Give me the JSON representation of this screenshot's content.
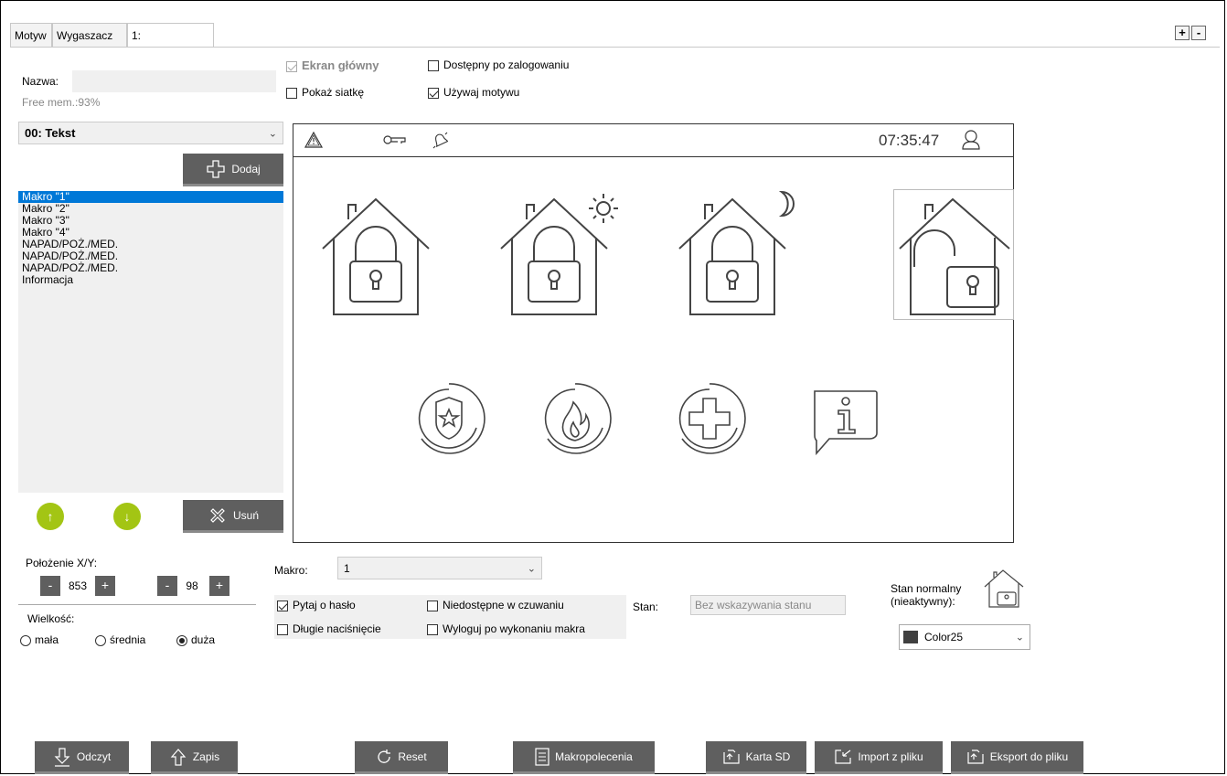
{
  "tabs": [
    {
      "label": "Motyw",
      "active": false
    },
    {
      "label": "Wygaszacz",
      "active": false
    },
    {
      "label": "1:",
      "active": true
    }
  ],
  "tab_controls": {
    "add": "+",
    "remove": "-"
  },
  "name_label": "Nazwa:",
  "name_value": "",
  "free_mem": "Free mem.:93%",
  "element_select": "00: Tekst",
  "add_button": "Dodaj",
  "macro_list": [
    {
      "label": "Makro \"1\"",
      "selected": true
    },
    {
      "label": "Makro \"2\"",
      "selected": false
    },
    {
      "label": "Makro \"3\"",
      "selected": false
    },
    {
      "label": "Makro \"4\"",
      "selected": false
    },
    {
      "label": "NAPAD/POŻ./MED.",
      "selected": false
    },
    {
      "label": "NAPAD/POŻ./MED.",
      "selected": false
    },
    {
      "label": "NAPAD/POŻ./MED.",
      "selected": false
    },
    {
      "label": "Informacja",
      "selected": false
    }
  ],
  "up_button": "↑",
  "down_button": "↓",
  "delete_button": "Usuń",
  "options": {
    "main_screen": {
      "label": "Ekran główny",
      "checked": true,
      "disabled": true
    },
    "available_after_login": {
      "label": "Dostępny po zalogowaniu",
      "checked": false
    },
    "show_grid": {
      "label": "Pokaż siatkę",
      "checked": false
    },
    "use_theme": {
      "label": "Używaj motywu",
      "checked": true
    }
  },
  "preview": {
    "clock": "07:35:47",
    "top_icons": [
      "warning-icon",
      "key-icon",
      "bell-icon",
      "user-icon"
    ],
    "row1_icons": [
      "house-lock-icon",
      "house-lock-day-icon",
      "house-lock-night-icon",
      "house-unlock-icon"
    ],
    "row2_icons": [
      "police-badge-icon",
      "fire-icon",
      "medical-cross-icon",
      "info-icon"
    ]
  },
  "position": {
    "label": "Położenie X/Y:",
    "x": "853",
    "y": "98",
    "minus": "-",
    "plus": "+"
  },
  "size": {
    "label": "Wielkość:",
    "options": [
      {
        "label": "mała",
        "checked": false
      },
      {
        "label": "średnia",
        "checked": false
      },
      {
        "label": "duża",
        "checked": true
      }
    ]
  },
  "macro": {
    "label": "Makro:",
    "value": "1"
  },
  "macro_options": {
    "ask_password": {
      "label": "Pytaj o hasło",
      "checked": true
    },
    "unavailable_armed": {
      "label": "Niedostępne w czuwaniu",
      "checked": false
    },
    "long_press": {
      "label": "Długie naciśnięcie",
      "checked": false
    },
    "logout_after": {
      "label": "Wyloguj po wykonaniu makra",
      "checked": false
    }
  },
  "state": {
    "label": "Stan:",
    "value": "Bez wskazywania stanu"
  },
  "normal_state": {
    "label_line1": "Stan normalny",
    "label_line2": "(nieaktywny):",
    "color_value": "Color25",
    "color_swatch": "#404040"
  },
  "bottom_buttons": {
    "read": "Odczyt",
    "write": "Zapis",
    "reset": "Reset",
    "macro_commands": "Makropolecenia",
    "sd_card": "Karta SD",
    "import": "Import z pliku",
    "export": "Eksport do pliku"
  },
  "colors": {
    "dark_button": "#5f5f5f",
    "green_button": "#a3c514",
    "selection": "#0078d7"
  }
}
